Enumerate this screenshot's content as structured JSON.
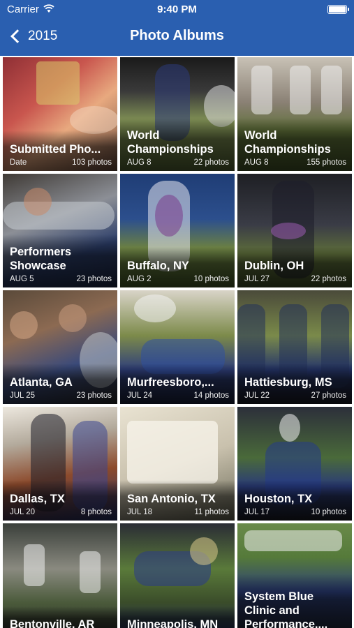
{
  "status_bar": {
    "carrier": "Carrier",
    "time": "9:40 PM"
  },
  "nav": {
    "back_label": "2015",
    "title": "Photo Albums"
  },
  "albums": [
    {
      "title": "Submitted Pho...",
      "date": "Date",
      "count": "103 photos"
    },
    {
      "title": "World Championships",
      "date": "AUG 8",
      "count": "22 photos"
    },
    {
      "title": "World Championships",
      "date": "AUG 8",
      "count": "155 photos"
    },
    {
      "title": "Performers Showcase",
      "date": "AUG 5",
      "count": "23 photos"
    },
    {
      "title": "Buffalo, NY",
      "date": "AUG 2",
      "count": "10 photos"
    },
    {
      "title": "Dublin, OH",
      "date": "JUL 27",
      "count": "22 photos"
    },
    {
      "title": "Atlanta, GA",
      "date": "JUL 25",
      "count": "23 photos"
    },
    {
      "title": "Murfreesboro,...",
      "date": "JUL 24",
      "count": "14 photos"
    },
    {
      "title": "Hattiesburg, MS",
      "date": "JUL 22",
      "count": "27 photos"
    },
    {
      "title": "Dallas, TX",
      "date": "JUL 20",
      "count": "8 photos"
    },
    {
      "title": "San Antonio, TX",
      "date": "JUL 18",
      "count": "11 photos"
    },
    {
      "title": "Houston, TX",
      "date": "JUL 17",
      "count": "10 photos"
    },
    {
      "title": "Bentonville, AR",
      "date": "",
      "count": ""
    },
    {
      "title": "Minneapolis, MN",
      "date": "",
      "count": ""
    },
    {
      "title": "System Blue Clinic and Performance,...",
      "date": "",
      "count": ""
    }
  ],
  "colors": {
    "nav_bar": "#2a5fb0",
    "text": "#ffffff"
  }
}
